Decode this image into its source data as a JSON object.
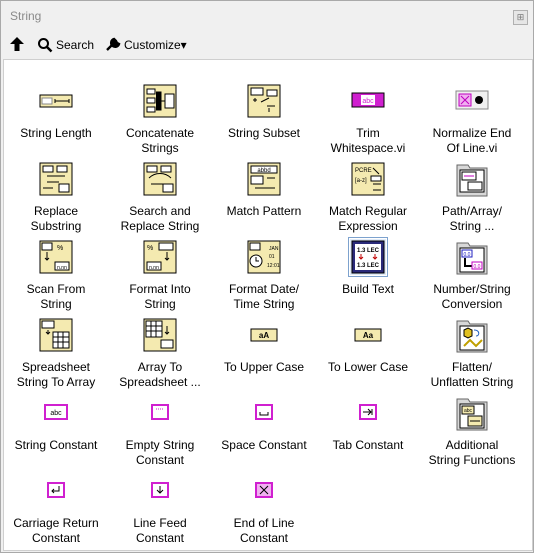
{
  "window": {
    "title": "String"
  },
  "toolbar": {
    "up_icon": "arrow-up-icon",
    "search_label": "Search",
    "customize_label": "Customize▾"
  },
  "palette": {
    "items": [
      {
        "label": "String Length"
      },
      {
        "label": "Concatenate\nStrings"
      },
      {
        "label": "String Subset"
      },
      {
        "label": "Trim\nWhitespace.vi"
      },
      {
        "label": "Normalize End\nOf Line.vi"
      },
      {
        "label": "Replace\nSubstring"
      },
      {
        "label": "Search and\nReplace String"
      },
      {
        "label": "Match Pattern"
      },
      {
        "label": "Match Regular\nExpression"
      },
      {
        "label": "Path/Array/\nString ..."
      },
      {
        "label": "Scan From\nString"
      },
      {
        "label": "Format Into\nString"
      },
      {
        "label": "Format Date/\nTime String"
      },
      {
        "label": "Build Text"
      },
      {
        "label": "Number/String\nConversion"
      },
      {
        "label": "Spreadsheet\nString To Array"
      },
      {
        "label": "Array To\nSpreadsheet ..."
      },
      {
        "label": "To Upper Case"
      },
      {
        "label": "To Lower Case"
      },
      {
        "label": "Flatten/\nUnflatten String"
      },
      {
        "label": "String Constant"
      },
      {
        "label": "Empty String\nConstant"
      },
      {
        "label": "Space Constant"
      },
      {
        "label": "Tab Constant"
      },
      {
        "label": "Additional\nString Functions"
      },
      {
        "label": "Carriage Return\nConstant"
      },
      {
        "label": "Line Feed\nConstant"
      },
      {
        "label": "End of Line\nConstant"
      }
    ]
  }
}
